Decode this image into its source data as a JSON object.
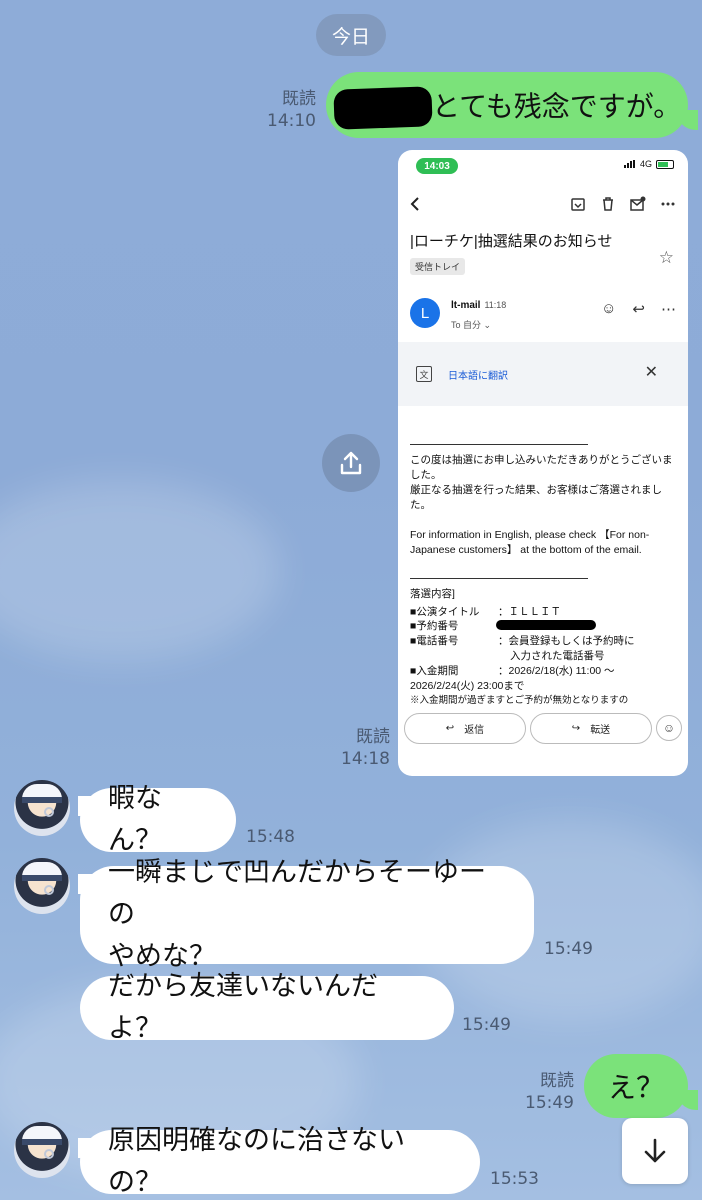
{
  "date_separator": "今日",
  "messages_out": [
    {
      "read_label": "既読",
      "time": "14:10",
      "text": "とても残念ですが。"
    },
    {
      "read_label": "既読",
      "time": "14:18"
    },
    {
      "read_label": "既読",
      "time": "15:49",
      "text": "え？"
    }
  ],
  "messages_in": [
    {
      "lines": [
        "暇なん？"
      ],
      "time": "15:48"
    },
    {
      "lines": [
        "一瞬まじで凹んだからそーゆーの",
        "やめな？"
      ],
      "time": "15:49"
    },
    {
      "lines": [
        "だから友達いないんだよ？"
      ],
      "time": "15:49"
    },
    {
      "lines": [
        "原因明確なのに治さないの？"
      ],
      "time": "15:53"
    }
  ],
  "screenshot": {
    "status_time": "14:03",
    "network": "4G",
    "subject": "|ローチケ|抽選結果のお知らせ",
    "label": "受信トレイ",
    "sender_initial": "L",
    "sender": "lt-mail",
    "sent_time": "11:18",
    "to": "To 自分 ⌄",
    "translate": "日本語に翻訳",
    "body": {
      "p1": "この度は抽選にお申し込みいただきありがとうございました。",
      "p2": "厳正なる抽選を行った結果、お客様はご落選されました。",
      "p3": "For information in English, please check 【For non-Japanese customers】 at the bottom of the email.",
      "section": "落選内容]",
      "row1_label": "■公演タイトル",
      "row1_value": "：ＩＬＬＩＴ",
      "row2_label": "■予約番号",
      "row3_label": "■電話番号",
      "row3_value": "：会員登録もしくは予約時に",
      "row3_value2": "入力された電話番号",
      "row4_label": "■入金期間",
      "row4_value": "：2026/2/18(水) 11:00 〜",
      "row4_value2": "2026/2/24(火) 23:00まで",
      "note": "※入金期間が過ぎますとご予約が無効となりますの"
    },
    "reply": "返信",
    "forward": "転送"
  },
  "icons": {
    "share": "share-icon",
    "scroll_down": "arrow-down-icon"
  },
  "colors": {
    "outgoing": "#7be27a",
    "incoming": "#ffffff",
    "background": "#8eacd8"
  }
}
